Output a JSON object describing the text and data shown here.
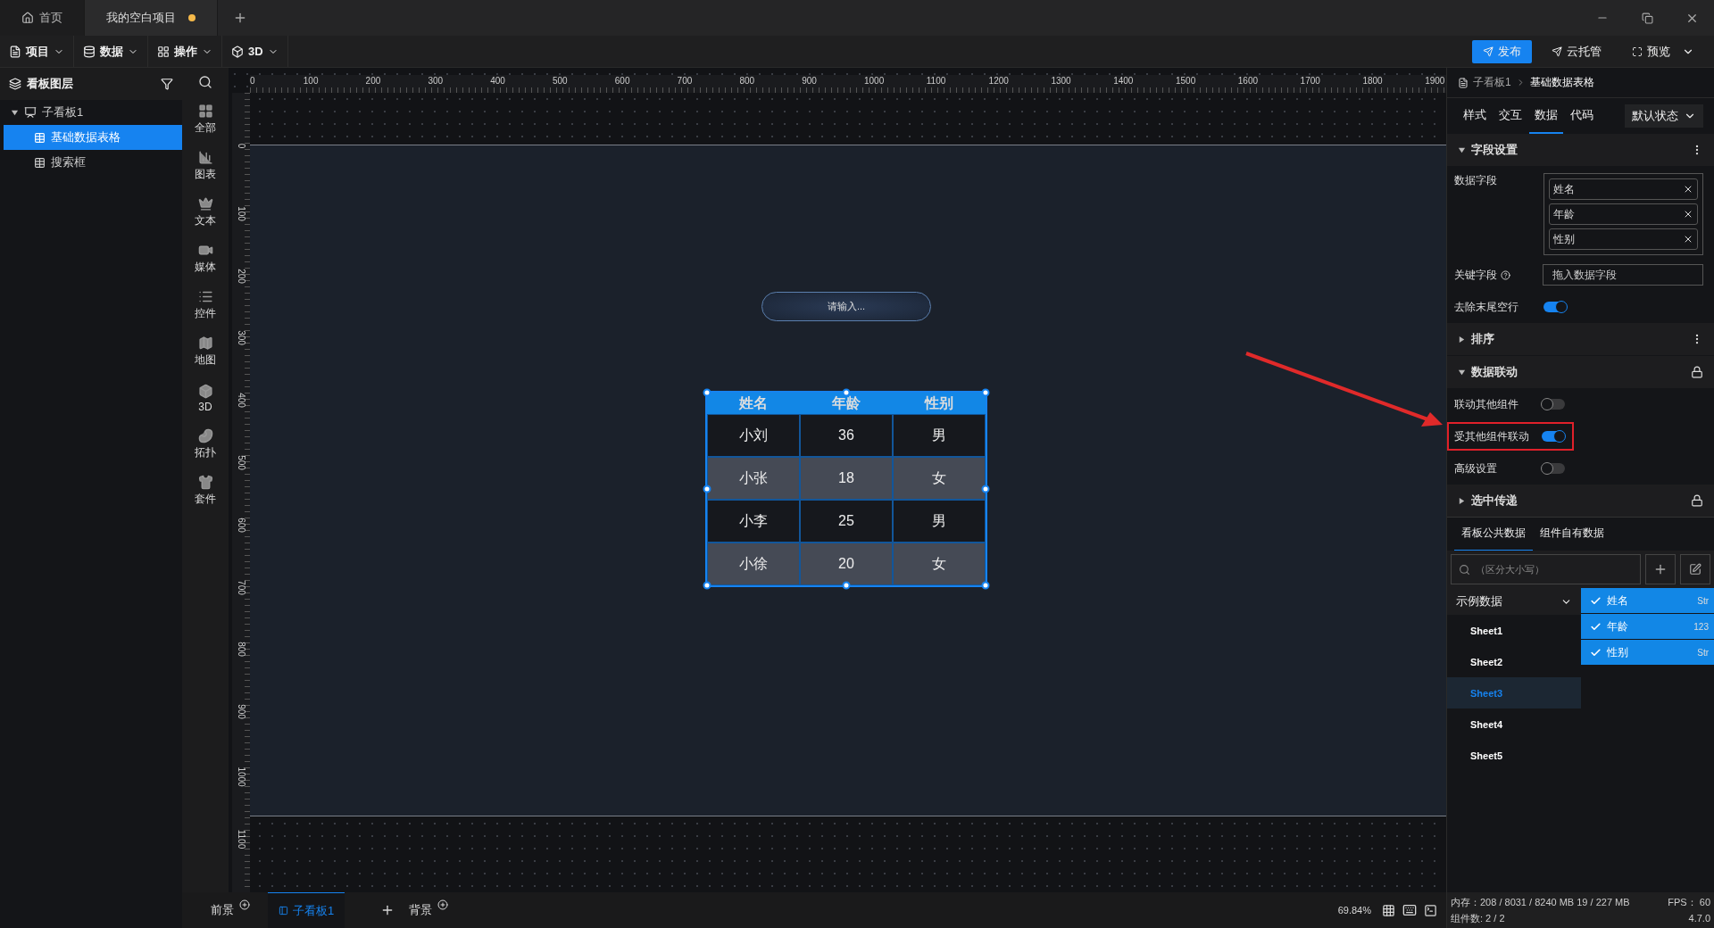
{
  "title_tabs": [
    {
      "label": "首页",
      "kind": "home",
      "selected": false,
      "unsaved": false
    },
    {
      "label": "我的空白项目",
      "kind": "project",
      "selected": true,
      "unsaved": true
    }
  ],
  "menu": [
    {
      "label": "项目"
    },
    {
      "label": "数据"
    },
    {
      "label": "操作"
    },
    {
      "label": "3D"
    }
  ],
  "actions": [
    {
      "label": "发布",
      "primary": true
    },
    {
      "label": "云托管",
      "primary": false
    },
    {
      "label": "预览",
      "primary": false
    }
  ],
  "layers": {
    "title": "看板图层",
    "tree": [
      {
        "label": "子看板1",
        "expanded": true,
        "selected": false,
        "children": [
          {
            "label": "基础数据表格",
            "selected": true
          },
          {
            "label": "搜索框",
            "selected": false
          }
        ]
      }
    ]
  },
  "component_bar": [
    "全部",
    "图表",
    "文本",
    "媒体",
    "控件",
    "地图",
    "3D",
    "拓扑",
    "套件"
  ],
  "ruler": {
    "x_labels": [
      "0",
      "100",
      "200",
      "300",
      "400",
      "500",
      "600",
      "700",
      "800",
      "900",
      "1000",
      "1100",
      "1200",
      "1300",
      "1400",
      "1500",
      "1600",
      "1700",
      "1800",
      "1900"
    ],
    "y_labels": [
      "0",
      "100",
      "200",
      "300",
      "400",
      "500",
      "600",
      "700",
      "800",
      "900",
      "1000",
      "1100"
    ]
  },
  "canvas": {
    "search_box": {
      "placeholder": "请输入..."
    },
    "table": {
      "selected": true,
      "columns": [
        "姓名",
        "年龄",
        "性别"
      ],
      "rows": [
        [
          "小刘",
          "36",
          "男"
        ],
        [
          "小张",
          "18",
          "女"
        ],
        [
          "小李",
          "25",
          "男"
        ],
        [
          "小徐",
          "20",
          "女"
        ]
      ]
    }
  },
  "bottom_bar": {
    "tabs": [
      {
        "label": "前景",
        "selected": false
      },
      {
        "label": "子看板1",
        "selected": true
      },
      {
        "label": "背景",
        "selected": false
      }
    ],
    "zoom": "69.84%"
  },
  "inspector": {
    "breadcrumb": [
      "子看板1",
      "基础数据表格"
    ],
    "tabs": [
      {
        "label": "样式",
        "selected": false
      },
      {
        "label": "交互",
        "selected": false
      },
      {
        "label": "数据",
        "selected": true
      },
      {
        "label": "代码",
        "selected": false
      }
    ],
    "state_select": "默认状态",
    "field_section": {
      "title": "字段设置",
      "expanded": true,
      "data_fields_label": "数据字段",
      "data_fields": [
        "姓名",
        "年龄",
        "性别"
      ],
      "key_field_label": "关键字段",
      "key_field_placeholder": "拖入数据字段",
      "trim_label": "去除末尾空行",
      "trim_on": true
    },
    "sort_section": {
      "title": "排序",
      "expanded": false
    },
    "link_section": {
      "title": "数据联动",
      "expanded": true,
      "locked": true,
      "rows": [
        {
          "label": "联动其他组件",
          "on": false,
          "highlighted": false
        },
        {
          "label": "受其他组件联动",
          "on": true,
          "highlighted": true
        },
        {
          "label": "高级设置",
          "on": false,
          "highlighted": false
        }
      ]
    },
    "select_section": {
      "title": "选中传递",
      "expanded": false,
      "locked": true
    }
  },
  "data_panel": {
    "tabs": [
      {
        "label": "看板公共数据",
        "selected": true
      },
      {
        "label": "组件自有数据",
        "selected": false
      }
    ],
    "search_placeholder": "（区分大小写）",
    "dataset": {
      "label": "示例数据",
      "expanded": true,
      "sheets": [
        {
          "label": "Sheet1",
          "selected": false
        },
        {
          "label": "Sheet2",
          "selected": false
        },
        {
          "label": "Sheet3",
          "selected": true
        },
        {
          "label": "Sheet4",
          "selected": false
        },
        {
          "label": "Sheet5",
          "selected": false
        }
      ]
    },
    "fields": [
      {
        "label": "姓名",
        "type": "Str",
        "checked": true
      },
      {
        "label": "年龄",
        "type": "123",
        "checked": true
      },
      {
        "label": "性别",
        "type": "Str",
        "checked": true
      }
    ]
  },
  "status": {
    "memory": "内存：208 / 8031 / 8240 MB  19 / 227 MB",
    "fps": "FPS： 60",
    "components": "组件数: 2 / 2",
    "version": "4.7.0"
  }
}
